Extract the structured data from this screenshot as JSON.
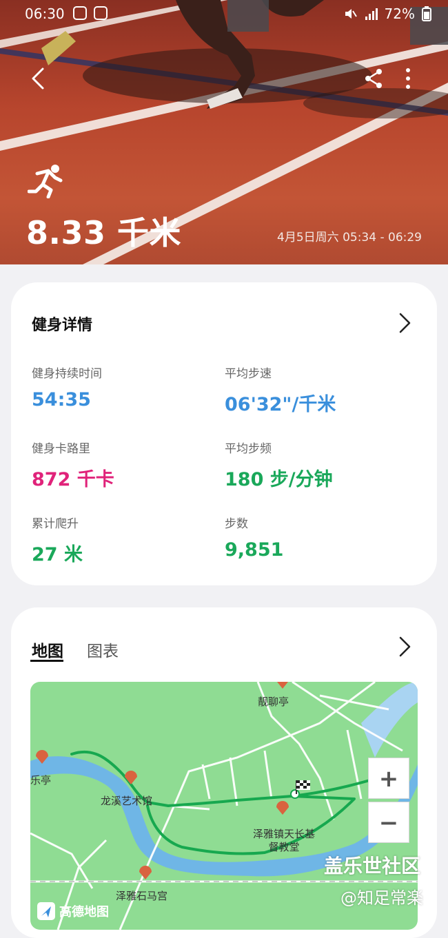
{
  "status_bar": {
    "time": "06:30",
    "battery": "72%"
  },
  "hero": {
    "distance": "8.33 千米",
    "datetime": "4月5日周六 05:34 - 06:29"
  },
  "details": {
    "title": "健身详情",
    "stats": [
      {
        "label": "健身持续时间",
        "value": "54:35",
        "color": "#3a8fdc"
      },
      {
        "label": "平均步速",
        "value": "06'32\"/千米",
        "color": "#3a8fdc"
      },
      {
        "label": "健身卡路里",
        "value": "872 千卡",
        "color": "#e0237a"
      },
      {
        "label": "平均步频",
        "value": "180 步/分钟",
        "color": "#1aa85a"
      },
      {
        "label": "累计爬升",
        "value": "27 米",
        "color": "#1aa85a"
      },
      {
        "label": "步数",
        "value": "9,851",
        "color": "#1aa85a"
      }
    ]
  },
  "map_card": {
    "tabs": [
      "地图",
      "图表"
    ],
    "map": {
      "labels": {
        "pavilion": "靓聊亭",
        "le_ting": "乐亭",
        "art_hall": "龙溪艺术馆",
        "church": "泽雅镇天长基督教堂",
        "temple": "泽雅石马宫"
      },
      "zoom_in": "+",
      "zoom_out": "−",
      "provider": "高德地图"
    }
  },
  "watermark": {
    "line1": "盖乐世社区",
    "line2": "@知足常楽"
  }
}
